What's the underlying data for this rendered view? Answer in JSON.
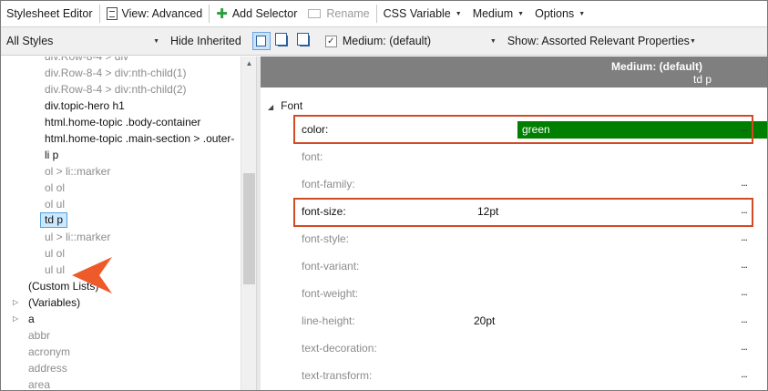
{
  "toolbar": {
    "title": "Stylesheet Editor",
    "view_label": "View: Advanced",
    "add_selector_label": "Add Selector",
    "rename_label": "Rename",
    "css_variable_label": "CSS Variable",
    "medium_label": "Medium",
    "options_label": "Options"
  },
  "filter": {
    "styles_select": "All Styles",
    "hide_inherited": "Hide Inherited",
    "medium_select": "Medium: (default)",
    "properties_select": "Show: Assorted Relevant Properties"
  },
  "tree": {
    "items": [
      {
        "label": "div.Row-8-4 > div:nth-child(1)",
        "state": "inherited"
      },
      {
        "label": "div.Row-8-4 > div:nth-child(2)",
        "state": "inherited"
      },
      {
        "label": "div.topic-hero h1",
        "state": "defined"
      },
      {
        "label": "html.home-topic .body-container",
        "state": "defined"
      },
      {
        "label": "html.home-topic .main-section > .outer-",
        "state": "defined"
      },
      {
        "label": "li p",
        "state": "defined"
      },
      {
        "label": "ol > li::marker",
        "state": "inherited"
      },
      {
        "label": "ol ol",
        "state": "inherited"
      },
      {
        "label": "ol ul",
        "state": "inherited"
      },
      {
        "label": "td p",
        "state": "selected"
      },
      {
        "label": "ul > li::marker",
        "state": "inherited"
      },
      {
        "label": "ul ol",
        "state": "inherited"
      },
      {
        "label": "ul ul",
        "state": "inherited"
      },
      {
        "label": "(Custom Lists)",
        "state": "defined"
      },
      {
        "label": "(Variables)",
        "state": "defined"
      },
      {
        "label": "a",
        "state": "defined"
      },
      {
        "label": "abbr",
        "state": "inherited"
      },
      {
        "label": "acronym",
        "state": "inherited"
      },
      {
        "label": "address",
        "state": "inherited"
      },
      {
        "label": "area",
        "state": "inherited"
      }
    ]
  },
  "properties": {
    "header_medium": "Medium: (default)",
    "header_selector": "td p",
    "group_label": "Font",
    "rows": [
      {
        "name": "color:",
        "value": "green",
        "swatch_color": "#007f00"
      },
      {
        "name": "font:",
        "value": ""
      },
      {
        "name": "font-family:",
        "value": ""
      },
      {
        "name": "font-size:",
        "value": "12pt"
      },
      {
        "name": "font-style:",
        "value": ""
      },
      {
        "name": "font-variant:",
        "value": ""
      },
      {
        "name": "font-weight:",
        "value": ""
      },
      {
        "name": "line-height:",
        "value": "20pt"
      },
      {
        "name": "text-decoration:",
        "value": ""
      },
      {
        "name": "text-transform:",
        "value": ""
      }
    ],
    "more_button": "..."
  },
  "colors": {
    "highlight": "#d24a26",
    "selection": "#cce8ff",
    "swatch_green": "#007f00",
    "callout": "#ee5a2a"
  },
  "icons": {
    "view": "document-icon",
    "add_selector": "green-plus-icon",
    "rename": "rename-icon"
  }
}
